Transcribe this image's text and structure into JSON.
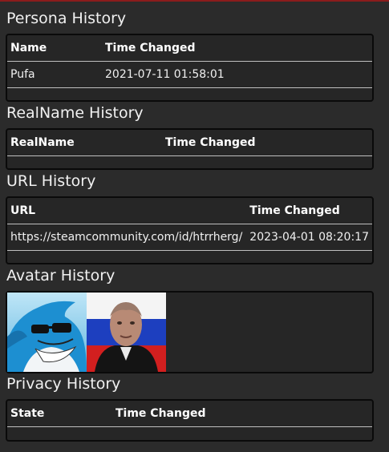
{
  "persona": {
    "title": "Persona History",
    "headers": [
      "Name",
      "Time Changed"
    ],
    "rows": [
      {
        "name": "Pufa",
        "time": "2021-07-11 01:58:01"
      }
    ]
  },
  "realname": {
    "title": "RealName History",
    "headers": [
      "RealName",
      "Time Changed"
    ]
  },
  "url": {
    "title": "URL History",
    "headers": [
      "URL",
      "Time Changed"
    ],
    "rows": [
      {
        "url": "https://steamcommunity.com/id/htrrherg/",
        "time": "2023-04-01 08:20:17"
      }
    ]
  },
  "avatar": {
    "title": "Avatar History",
    "items": [
      "shark-with-sunglasses-icon",
      "man-with-russian-flag-icon"
    ]
  },
  "privacy": {
    "title": "Privacy History",
    "headers": [
      "State",
      "Time Changed"
    ]
  }
}
